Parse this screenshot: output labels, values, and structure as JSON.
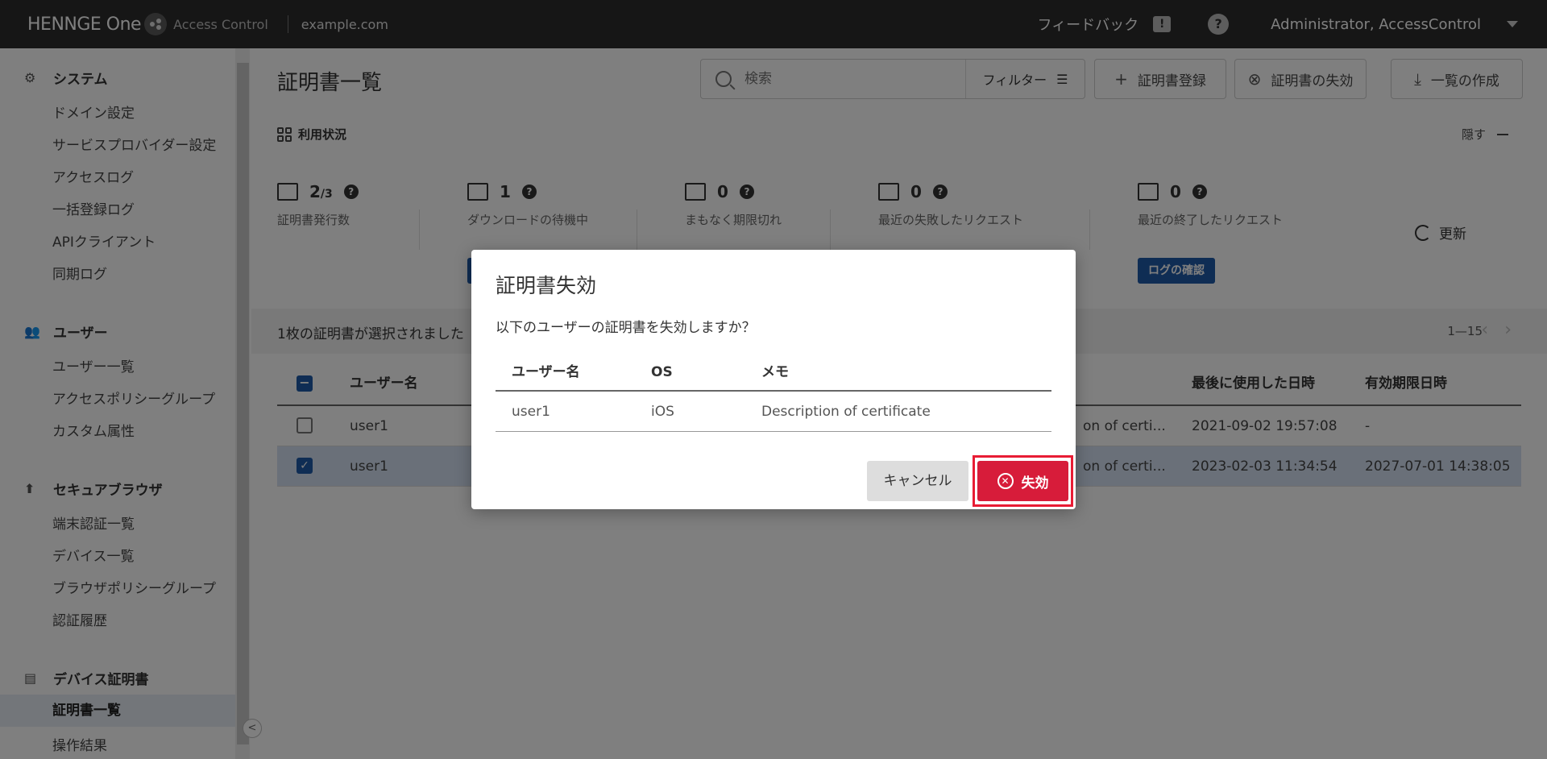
{
  "header": {
    "brand": "HENNGE One",
    "app": "Access Control",
    "domain": "example.com",
    "feedback": "フィードバック",
    "user": "Administrator, AccessControl"
  },
  "sidebar": {
    "sections": [
      {
        "title": "システム",
        "icon": "gear-icon",
        "items": [
          "ドメイン設定",
          "サービスプロバイダー設定",
          "アクセスログ",
          "一括登録ログ",
          "APIクライアント",
          "同期ログ"
        ]
      },
      {
        "title": "ユーザー",
        "icon": "users-icon",
        "items": [
          "ユーザー一覧",
          "アクセスポリシーグループ",
          "カスタム属性"
        ]
      },
      {
        "title": "セキュアブラウザ",
        "icon": "browser-icon",
        "items": [
          "端末認証一覧",
          "デバイス一覧",
          "ブラウザポリシーグループ",
          "認証履歴"
        ]
      },
      {
        "title": "デバイス証明書",
        "icon": "certificate-icon",
        "items": [
          "証明書一覧",
          "操作結果"
        ]
      }
    ],
    "active": "証明書一覧"
  },
  "main": {
    "title": "証明書一覧",
    "search_placeholder": "検索",
    "filter": "フィルター",
    "register": "証明書登録",
    "revoke": "証明書の失効",
    "export": "一覧の作成",
    "usage_title": "利用状況",
    "hide": "隠す",
    "refresh": "更新",
    "log_button": "ログの確認",
    "stats": [
      {
        "value": "2",
        "suffix": "/3",
        "label": "証明書発行数"
      },
      {
        "value": "1",
        "suffix": "",
        "label": "ダウンロードの待機中"
      },
      {
        "value": "0",
        "suffix": "",
        "label": "まもなく期限切れ"
      },
      {
        "value": "0",
        "suffix": "",
        "label": "最近の失敗したリクエスト"
      },
      {
        "value": "0",
        "suffix": "",
        "label": "最近の終了したリクエスト"
      }
    ],
    "selection_text": "1枚の証明書が選択されました",
    "pagination": "1—15",
    "columns": {
      "username": "ユーザー名",
      "last_used": "最後に使用した日時",
      "expiry": "有効期限日時"
    },
    "rows": [
      {
        "username": "user1",
        "memo_tail": "on of certi...",
        "last_used": "2021-09-02 19:57:08",
        "expiry": "-",
        "selected": false
      },
      {
        "username": "user1",
        "memo_tail": "on of certi...",
        "last_used": "2023-02-03 11:34:54",
        "expiry": "2027-07-01 14:38:05",
        "selected": true
      }
    ]
  },
  "modal": {
    "title": "証明書失効",
    "message": "以下のユーザーの証明書を失効しますか？",
    "columns": {
      "username": "ユーザー名",
      "os": "OS",
      "memo": "メモ"
    },
    "row": {
      "username": "user1",
      "os": "iOS",
      "memo": "Description of certificate"
    },
    "cancel": "キャンセル",
    "confirm": "失効"
  },
  "colors": {
    "accent": "#1e5aa8",
    "danger": "#d71c3a",
    "topbar": "#2d2d2d"
  }
}
